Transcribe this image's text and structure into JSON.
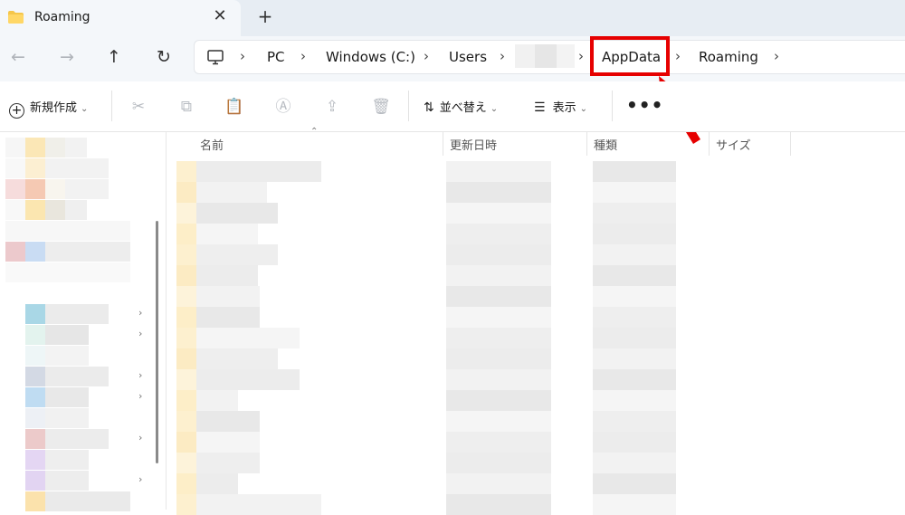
{
  "tab": {
    "title": "Roaming",
    "close": "✕",
    "new_tab": "+"
  },
  "nav": {
    "back": "←",
    "forward": "→",
    "up": "↑",
    "refresh": "↻"
  },
  "breadcrumb": {
    "items": [
      "PC",
      "Windows (C:)",
      "Users",
      "AppData",
      "Roaming"
    ],
    "separator": "›",
    "highlighted": "AppData",
    "highlight_color": "#e60000"
  },
  "toolbar": {
    "new_label": "新規作成",
    "sort_label": "並べ替え",
    "view_label": "表示",
    "more": "•••"
  },
  "columns": {
    "name": "名前",
    "modified": "更新日時",
    "type": "種類",
    "size": "サイズ"
  },
  "colors": {
    "accent": "#e60000",
    "folder": "#f5c64a",
    "redacted": "#e6e6e6"
  }
}
